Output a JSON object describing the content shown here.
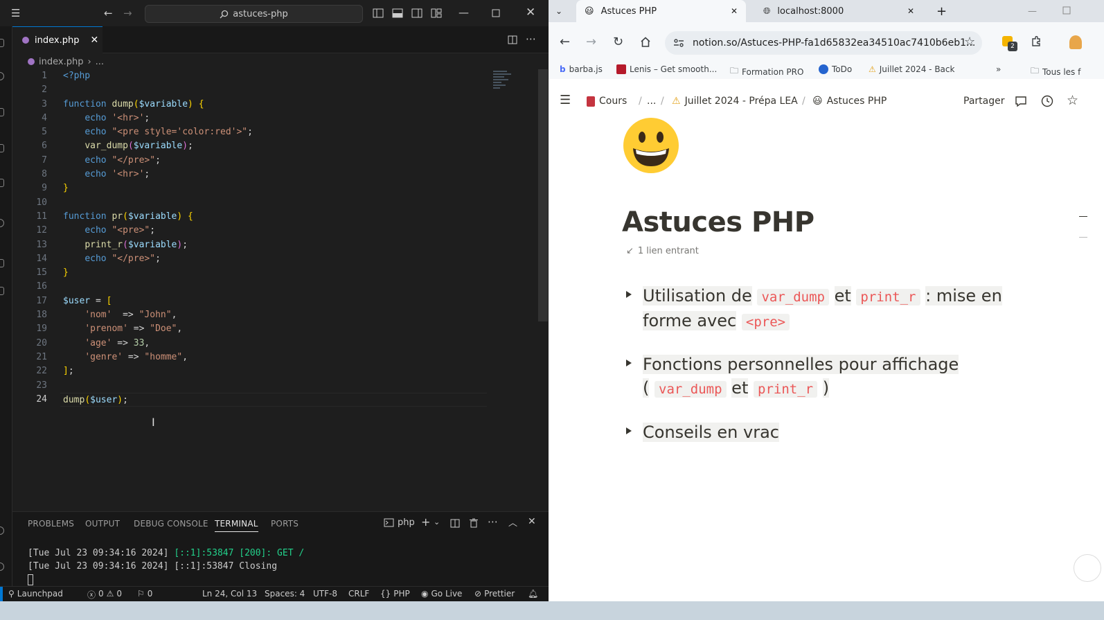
{
  "vscode": {
    "search_text": "astuces-php",
    "tab_label": "index.php",
    "breadcrumb_file": "index.php",
    "breadcrumb_more": "...",
    "line_numbers": [
      "1",
      "2",
      "3",
      "4",
      "5",
      "6",
      "7",
      "8",
      "9",
      "10",
      "11",
      "12",
      "13",
      "14",
      "15",
      "16",
      "17",
      "18",
      "19",
      "20",
      "21",
      "22",
      "23",
      "24"
    ],
    "panel_tabs": {
      "problems": "PROBLEMS",
      "output": "OUTPUT",
      "debug": "DEBUG CONSOLE",
      "terminal": "TERMINAL",
      "ports": "PORTS"
    },
    "terminal_profile": "php",
    "terminal_lines": {
      "line1_prefix": "[Tue Jul 23 09:34:16 2024] ",
      "line1_status": "[::1]:53847 [200]: GET /",
      "line2": "[Tue Jul 23 09:34:16 2024] [::1]:53847 Closing"
    },
    "status": {
      "launchpad": "Launchpad",
      "errors": "0",
      "warnings": "0",
      "ports": "0",
      "position": "Ln 24, Col 13",
      "spaces": "Spaces: 4",
      "encoding": "UTF-8",
      "eol": "CRLF",
      "language": "PHP",
      "golive": "Go Live",
      "prettier": "Prettier"
    }
  },
  "chrome": {
    "tabs": [
      {
        "title": "Astuces PHP"
      },
      {
        "title": "localhost:8000"
      }
    ],
    "url": "notion.so/Astuces-PHP-fa1d65832ea34510ac7410b6eb1...",
    "extension_badge": "2",
    "bookmarks": [
      "barba.js",
      "Lenis – Get smooth...",
      "Formation PRO",
      "ToDo",
      "Juillet 2024 - Back",
      "Tous les f"
    ],
    "breadcrumb": [
      "Cours",
      "...",
      "Juillet 2024 - Prépa LEA",
      "Astuces PHP"
    ],
    "share_label": "Partager",
    "page_title": "Astuces PHP",
    "backlinks": "1 lien entrant",
    "toggles": {
      "t1": {
        "a": "Utilisation de",
        "c1": "var_dump",
        "b": "et",
        "c2": "print_r",
        "d": ": mise en",
        "e": "forme avec",
        "c3": "<pre>"
      },
      "t2": {
        "a": "Fonctions personnelles pour affichage",
        "p1": "(",
        "c1": "var_dump",
        "b": "et",
        "c2": "print_r",
        "p2": ")"
      },
      "t3": {
        "a": "Conseils en vrac"
      }
    }
  },
  "colors": {
    "vscode_bg": "#1e1e1e",
    "accent": "#0078d4",
    "notion_code": "#eb5757"
  }
}
